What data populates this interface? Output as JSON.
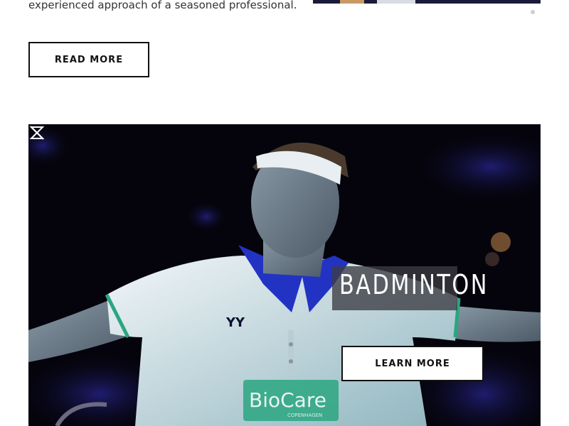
{
  "intro": {
    "text": "experienced approach of a seasoned professional."
  },
  "read_more": {
    "label": "READ MORE"
  },
  "hero": {
    "title": "BADMINTON",
    "shirt_brand": "BioCare",
    "shirt_brand_sub": "COPENHAGEN",
    "learn_more_label": "LEARN MORE",
    "logo_icon": "hummel-style-logo-icon"
  },
  "colors": {
    "hero_bg": "#05040c",
    "shirt": "#dfe8ec",
    "collar": "#2233c4",
    "accent_green": "#2aa680"
  }
}
